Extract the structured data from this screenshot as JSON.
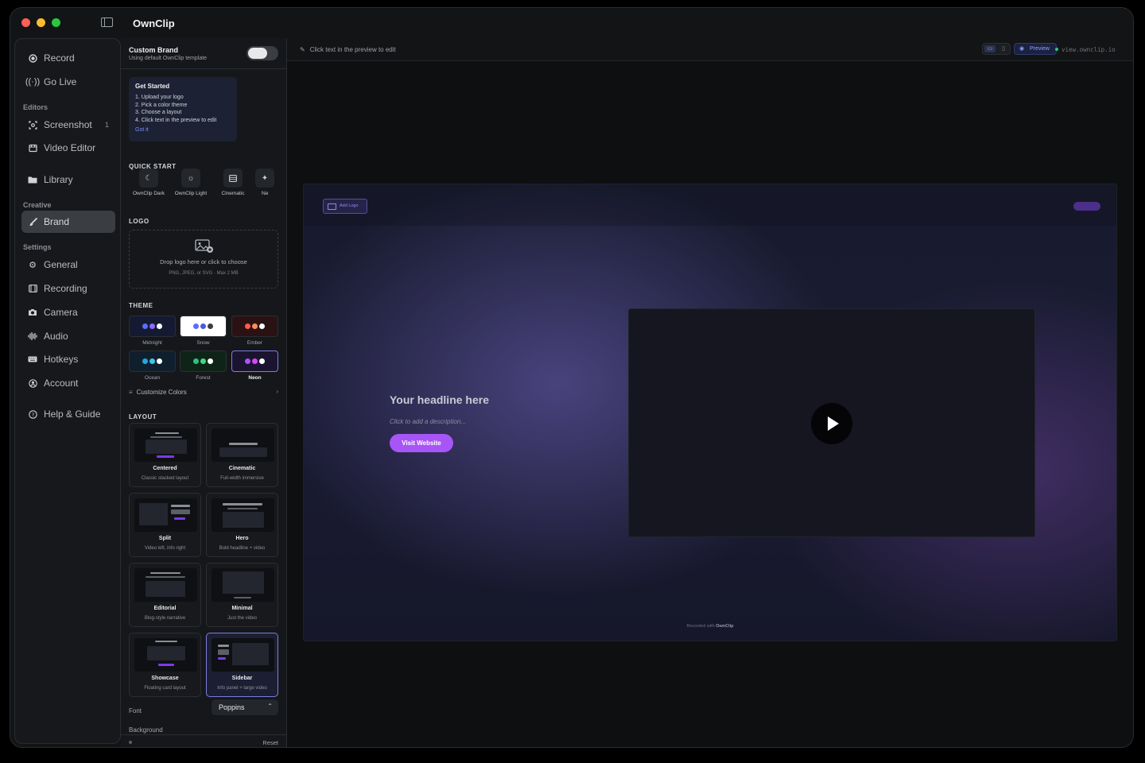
{
  "app": {
    "title": "OwnClip"
  },
  "nav": {
    "record": "Record",
    "go_live": "Go Live",
    "section_editors": "Editors",
    "screenshot": "Screenshot",
    "screenshot_count": "1",
    "video_editor": "Video Editor",
    "library": "Library",
    "section_creative": "Creative",
    "brand": "Brand",
    "section_settings": "Settings",
    "general": "General",
    "recording": "Recording",
    "camera": "Camera",
    "audio": "Audio",
    "hotkeys": "Hotkeys",
    "account": "Account",
    "help": "Help & Guide"
  },
  "panel": {
    "custom_brand_title": "Custom Brand",
    "custom_brand_sub": "Using default OwnClip template",
    "custom_brand_enabled": false,
    "get_started": {
      "title": "Get Started",
      "steps": [
        "1. Upload your logo",
        "2. Pick a color theme",
        "3. Choose a layout",
        "4. Click text in the preview to edit"
      ],
      "dismiss": "Got it"
    },
    "quick_start_label": "QUICK START",
    "quick_start": [
      "OwnClip Dark",
      "OwnClip Light",
      "Cinematic",
      "Ne"
    ],
    "logo_label": "LOGO",
    "logo_drop": "Drop logo here or click to choose",
    "logo_formats": "PNG, JPEG, or SVG · Max 2 MB",
    "theme_label": "THEME",
    "themes": [
      {
        "name": "Midnight",
        "bg": "#151a33",
        "dots": [
          "#5b6cff",
          "#8b6cff",
          "#ffffff"
        ]
      },
      {
        "name": "Snow",
        "bg": "#ffffff",
        "dots": [
          "#5b6cff",
          "#4b5bd6",
          "#3a3d42"
        ]
      },
      {
        "name": "Ember",
        "bg": "#2a1214",
        "dots": [
          "#ff5a4e",
          "#ff8a5c",
          "#ffffff"
        ]
      },
      {
        "name": "Ocean",
        "bg": "#0f1f2e",
        "dots": [
          "#1ea8e0",
          "#38c6f0",
          "#ffffff"
        ]
      },
      {
        "name": "Forest",
        "bg": "#0f2418",
        "dots": [
          "#2ec27e",
          "#3ddc84",
          "#ffffff"
        ]
      },
      {
        "name": "Neon",
        "bg": "#1a1430",
        "dots": [
          "#a855f7",
          "#d946ef",
          "#ffffff"
        ]
      }
    ],
    "selected_theme": "Neon",
    "customize_colors": "Customize Colors",
    "layout_label": "LAYOUT",
    "layouts": [
      {
        "name": "Centered",
        "desc": "Classic stacked layout"
      },
      {
        "name": "Cinematic",
        "desc": "Full-width immersive"
      },
      {
        "name": "Split",
        "desc": "Video left, info right"
      },
      {
        "name": "Hero",
        "desc": "Bold headline + video"
      },
      {
        "name": "Editorial",
        "desc": "Blog-style narrative"
      },
      {
        "name": "Minimal",
        "desc": "Just the video"
      },
      {
        "name": "Showcase",
        "desc": "Floating card layout"
      },
      {
        "name": "Sidebar",
        "desc": "Info panel + large video"
      }
    ],
    "selected_layout": "Sidebar",
    "font_label": "Font",
    "font_value": "Poppins",
    "background_label": "Background",
    "background_swatches": [
      "#5b4fd6",
      "#e0703a",
      "#2aa6c9",
      "#6b7bd6"
    ],
    "reset": "Reset"
  },
  "main": {
    "hint": "Click text in the preview to edit",
    "preview_label": "Preview",
    "url": "view.ownclip.io"
  },
  "preview": {
    "add_logo": "Add Logo",
    "headline": "Your headline here",
    "description": "Click to add a description...",
    "cta": "Visit Website",
    "recorded_with": "Recorded with",
    "brand": "OwnClip",
    "accent": "#a855f7"
  }
}
